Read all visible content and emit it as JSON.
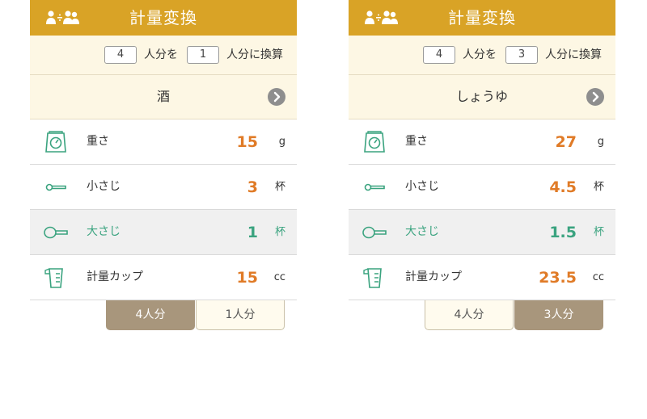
{
  "panels": [
    {
      "title": "計量変換",
      "convert": {
        "from": "4",
        "from_label": "人分を",
        "to": "1",
        "to_label": "人分に換算"
      },
      "ingredient": "酒",
      "rows": [
        {
          "label": "重さ",
          "value": "15",
          "unit": "g"
        },
        {
          "label": "小さじ",
          "value": "3",
          "unit": "杯"
        },
        {
          "label": "大さじ",
          "value": "1",
          "unit": "杯"
        },
        {
          "label": "計量カップ",
          "value": "15",
          "unit": "cc"
        }
      ],
      "tabs": [
        {
          "label": "4人分",
          "active": true
        },
        {
          "label": "1人分",
          "active": false
        }
      ]
    },
    {
      "title": "計量変換",
      "convert": {
        "from": "4",
        "from_label": "人分を",
        "to": "3",
        "to_label": "人分に換算"
      },
      "ingredient": "しょうゆ",
      "rows": [
        {
          "label": "重さ",
          "value": "27",
          "unit": "g"
        },
        {
          "label": "小さじ",
          "value": "4.5",
          "unit": "杯"
        },
        {
          "label": "大さじ",
          "value": "1.5",
          "unit": "杯"
        },
        {
          "label": "計量カップ",
          "value": "23.5",
          "unit": "cc"
        }
      ],
      "tabs": [
        {
          "label": "4人分",
          "active": false
        },
        {
          "label": "3人分",
          "active": true
        }
      ]
    }
  ],
  "icons": [
    "users-convert-icon",
    "chevron-right-icon",
    "scale-icon",
    "teaspoon-icon",
    "tablespoon-icon",
    "measuring-cup-icon"
  ],
  "colors": {
    "header": "#d9a326",
    "value": "#e07b27",
    "highlight": "#3aa37f",
    "active_tab": "#a8967c"
  }
}
